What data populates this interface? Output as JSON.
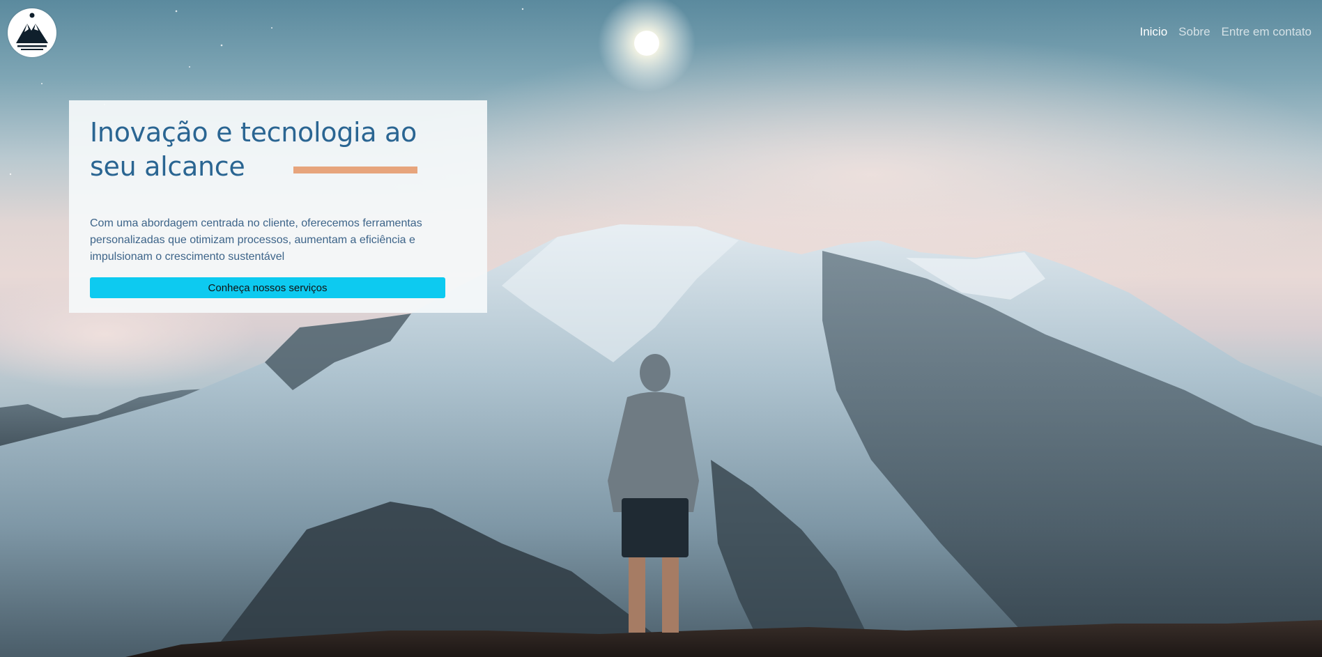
{
  "logo": {
    "icon": "mountain-logo-icon"
  },
  "nav": {
    "items": [
      {
        "label": "Inicio",
        "active": true
      },
      {
        "label": "Sobre",
        "active": false
      },
      {
        "label": "Entre em contato",
        "active": false
      }
    ]
  },
  "hero": {
    "title": "Inovação e tecnologia ao seu alcance",
    "description": "Com uma abordagem centrada no cliente, oferecemos ferramentas personalizadas que otimizam processos, aumentam a eficiência e impulsionam o crescimento sustentável",
    "cta_label": "Conheça nossos serviços"
  },
  "colors": {
    "title": "#2a6592",
    "accent_bar": "#e7a47c",
    "cta": "#0dcaf0",
    "nav_active": "#ffffff"
  }
}
